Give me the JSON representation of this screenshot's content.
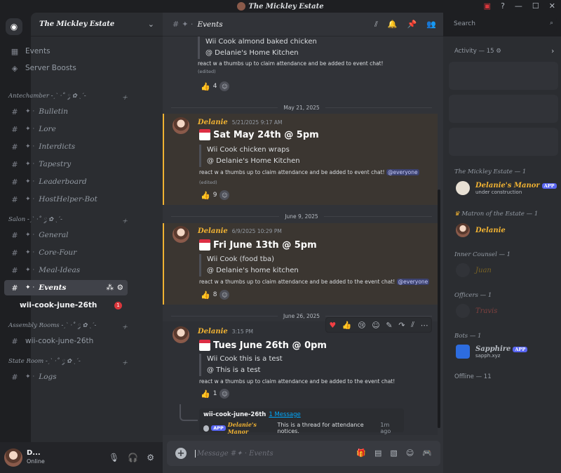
{
  "window": {
    "title": "The Mickley Estate",
    "icons": [
      "help-icon",
      "minimize-icon",
      "maximize-icon",
      "close-icon"
    ]
  },
  "server": {
    "name": "The Mickley Estate"
  },
  "sidebar": {
    "top": [
      {
        "label": "Events",
        "icon": "calendar-icon"
      },
      {
        "label": "Server Boosts",
        "icon": "boost-icon"
      }
    ],
    "categories": [
      {
        "name": "Antechamber ˗ˏˋ ·˚ ༘ ✿ ˎˊ˗",
        "channels": [
          "Bulletin",
          "Lore",
          "Interdicts",
          "Tapestry",
          "Leaderboard",
          "HostHelper-Bot"
        ]
      },
      {
        "name": "Salon ˗ˏˋ ·˚ ༘ ✿ ˎˊ˗",
        "channels": [
          "General",
          "Core-Four",
          "Meal-Ideas",
          "Events"
        ]
      },
      {
        "name": "Assembly Rooms ˗ˏˋ ·˚ ༘ ✿ ˎˊ˗",
        "channels": [
          "wii-cook-june-26th"
        ]
      },
      {
        "name": "State Room ˗ˏˋ ·˚ ༘ ✿ ˎˊ˗",
        "channels": [
          "Logs"
        ]
      }
    ],
    "thread": {
      "label": "wii-cook-june-26th",
      "badge": "1"
    }
  },
  "user": {
    "name": "D...",
    "status": "Online"
  },
  "channel": {
    "name": "Events",
    "search_placeholder": "Search"
  },
  "messages": [
    {
      "lines": [
        "Wii Cook almond baked chicken",
        "@ Delanie's Home Kitchen"
      ],
      "note": "react w a thumbs up to claim attendance and be added to event chat!",
      "edited": "(edited)",
      "reaction": "4"
    },
    {
      "divider": "May 21, 2025",
      "author": "Delanie",
      "time": "5/21/2025 9:17 AM",
      "heading": "Sat May 24th @ 5pm",
      "lines": [
        "Wii Cook chicken wraps",
        "@ Delanie's Home Kitchen"
      ],
      "note": "react w a thumbs up to claim attendance and be added to event chat!",
      "mention": "@everyone",
      "edited": "(edited)",
      "reaction": "9"
    },
    {
      "divider": "June 9, 2025",
      "author": "Delanie",
      "time": "6/9/2025 10:29 PM",
      "heading": "Fri June 13th @ 5pm",
      "lines": [
        "Wii Cook (food tba)",
        "@ Delanie's home kitchen"
      ],
      "note": "react w a thumbs up to claim attendance and be added to the event chat!",
      "mention": "@everyone",
      "reaction": "8"
    },
    {
      "divider": "June 26, 2025",
      "author": "Delanie",
      "time": "3:15 PM",
      "heading": "Tues June 26th @ 0pm",
      "lines": [
        "Wii Cook this is a test",
        "@ This is a test"
      ],
      "note": "react w a thumbs up to claim attendance and be added to the event chat!",
      "reaction": "1"
    }
  ],
  "thread_preview": {
    "name": "wii-cook-june-26th",
    "count": "1 Message",
    "bot": "Delanie's Manor",
    "tag": "APP",
    "text": "This is a thread for attendance notices.",
    "time": "1m ago"
  },
  "composer": {
    "placeholder": "Message #✦ · Events"
  },
  "members": {
    "activity": "Activity — 15",
    "groups": [
      {
        "title": "The Mickley Estate — 1",
        "members": [
          {
            "name": "Delanie's Manor",
            "tag": "APP",
            "sub": "under construction"
          }
        ]
      },
      {
        "title": "Matron of the Estate — 1",
        "members": [
          {
            "name": "Delanie"
          }
        ]
      },
      {
        "title": "Inner Counsel — 1",
        "members": [
          {
            "name": "Juan"
          }
        ]
      },
      {
        "title": "Officers — 1",
        "members": [
          {
            "name": "Travis"
          }
        ]
      },
      {
        "title": "Bots — 1",
        "members": [
          {
            "name": "Sapphire",
            "tag": "APP",
            "sub": "sapph.xyz"
          }
        ]
      }
    ],
    "offline": "Offline — 11"
  },
  "colors": {
    "accent": "#f0b232",
    "blurple": "#5865f2",
    "bg": "#313338"
  }
}
